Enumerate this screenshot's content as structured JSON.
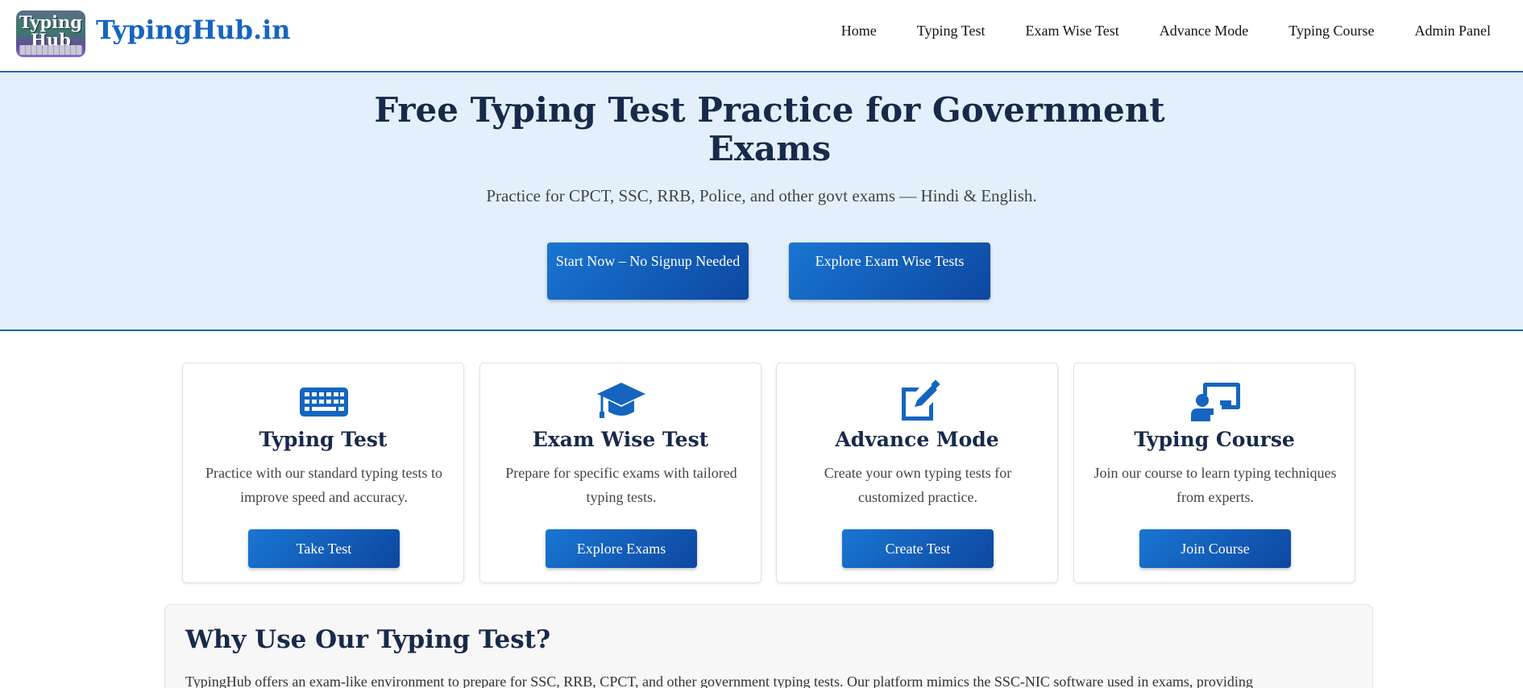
{
  "header": {
    "logo_line1": "Typing",
    "logo_line2": "Hub",
    "brand": "TypingHub.in",
    "nav": [
      "Home",
      "Typing Test",
      "Exam Wise Test",
      "Advance Mode",
      "Typing Course",
      "Admin Panel"
    ]
  },
  "hero": {
    "title": "Free Typing Test Practice for Government Exams",
    "subtitle": "Practice for CPCT, SSC, RRB, Police, and other govt exams — Hindi & English.",
    "primary_button": "Start Now – No Signup Needed",
    "secondary_button": "Explore Exam Wise Tests"
  },
  "cards": [
    {
      "icon": "keyboard-icon",
      "title": "Typing Test",
      "text": "Practice with our standard typing tests to improve speed and accuracy.",
      "button": "Take Test"
    },
    {
      "icon": "graduation-cap-icon",
      "title": "Exam Wise Test",
      "text": "Prepare for specific exams with tailored typing tests.",
      "button": "Explore Exams"
    },
    {
      "icon": "edit-icon",
      "title": "Advance Mode",
      "text": "Create your own typing tests for customized practice.",
      "button": "Create Test"
    },
    {
      "icon": "teacher-board-icon",
      "title": "Typing Course",
      "text": "Join our course to learn typing techniques from experts.",
      "button": "Join Course"
    }
  ],
  "why": {
    "title": "Why Use Our Typing Test?",
    "text": "TypingHub offers an exam-like environment to prepare for SSC, RRB, CPCT, and other government typing tests. Our platform mimics the SSC-NIC software used in exams, providing"
  },
  "colors": {
    "brand_blue": "#1565c0",
    "button_gradient_start": "#1976d2",
    "button_gradient_end": "#0d47a1",
    "hero_background": "#e3f0fb",
    "heading": "#182a4a"
  }
}
